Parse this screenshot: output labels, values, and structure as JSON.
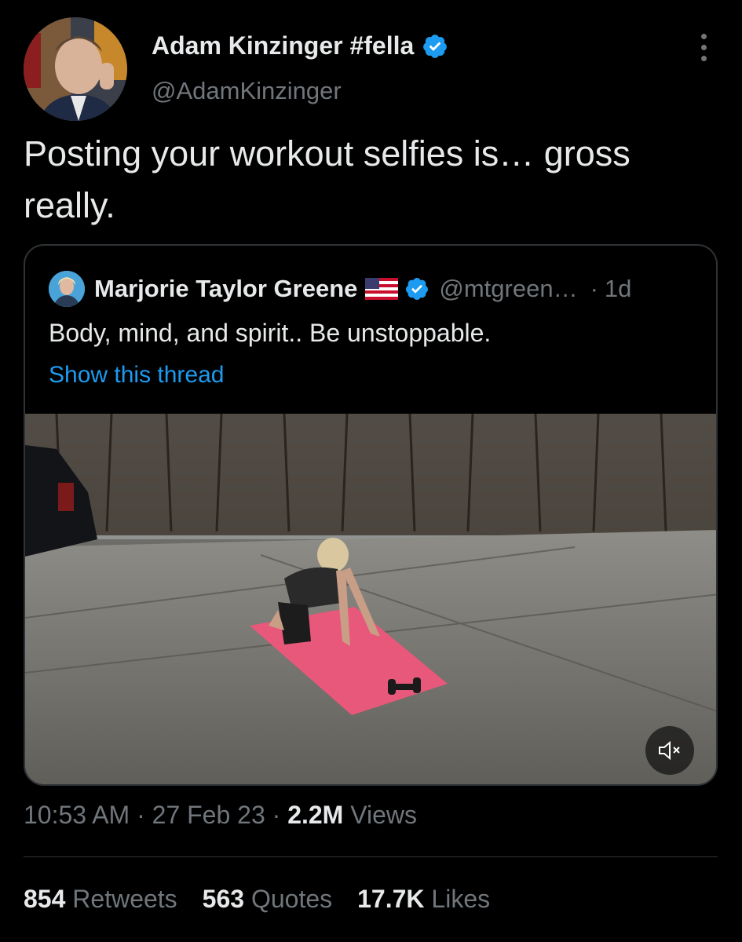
{
  "author": {
    "name": "Adam Kinzinger #fella",
    "handle": "@AdamKinzinger",
    "verified": true
  },
  "tweet": {
    "text": "Posting your workout selfies is… gross really."
  },
  "quoted_tweet": {
    "name": "Marjorie Taylor Greene",
    "flag": "us-flag-icon",
    "verified": true,
    "handle": "@mtgreen…",
    "separator": "·",
    "time": "1d",
    "text": "Body, mind, and spirit.. Be unstoppable.",
    "show_thread_label": "Show this thread",
    "media": {
      "type": "video",
      "mute_icon": "speaker-muted-icon"
    }
  },
  "meta": {
    "time": "10:53 AM",
    "sep1": "·",
    "date": "27 Feb 23",
    "sep2": "·",
    "views_count": "2.2M",
    "views_label": "Views"
  },
  "stats": {
    "retweets_count": "854",
    "retweets_label": "Retweets",
    "quotes_count": "563",
    "quotes_label": "Quotes",
    "likes_count": "17.7K",
    "likes_label": "Likes"
  },
  "colors": {
    "background": "#000000",
    "text": "#e7e9ea",
    "secondary": "#71767b",
    "link": "#1d9bf0",
    "verified": "#1d9bf0",
    "border": "#2f3336"
  }
}
